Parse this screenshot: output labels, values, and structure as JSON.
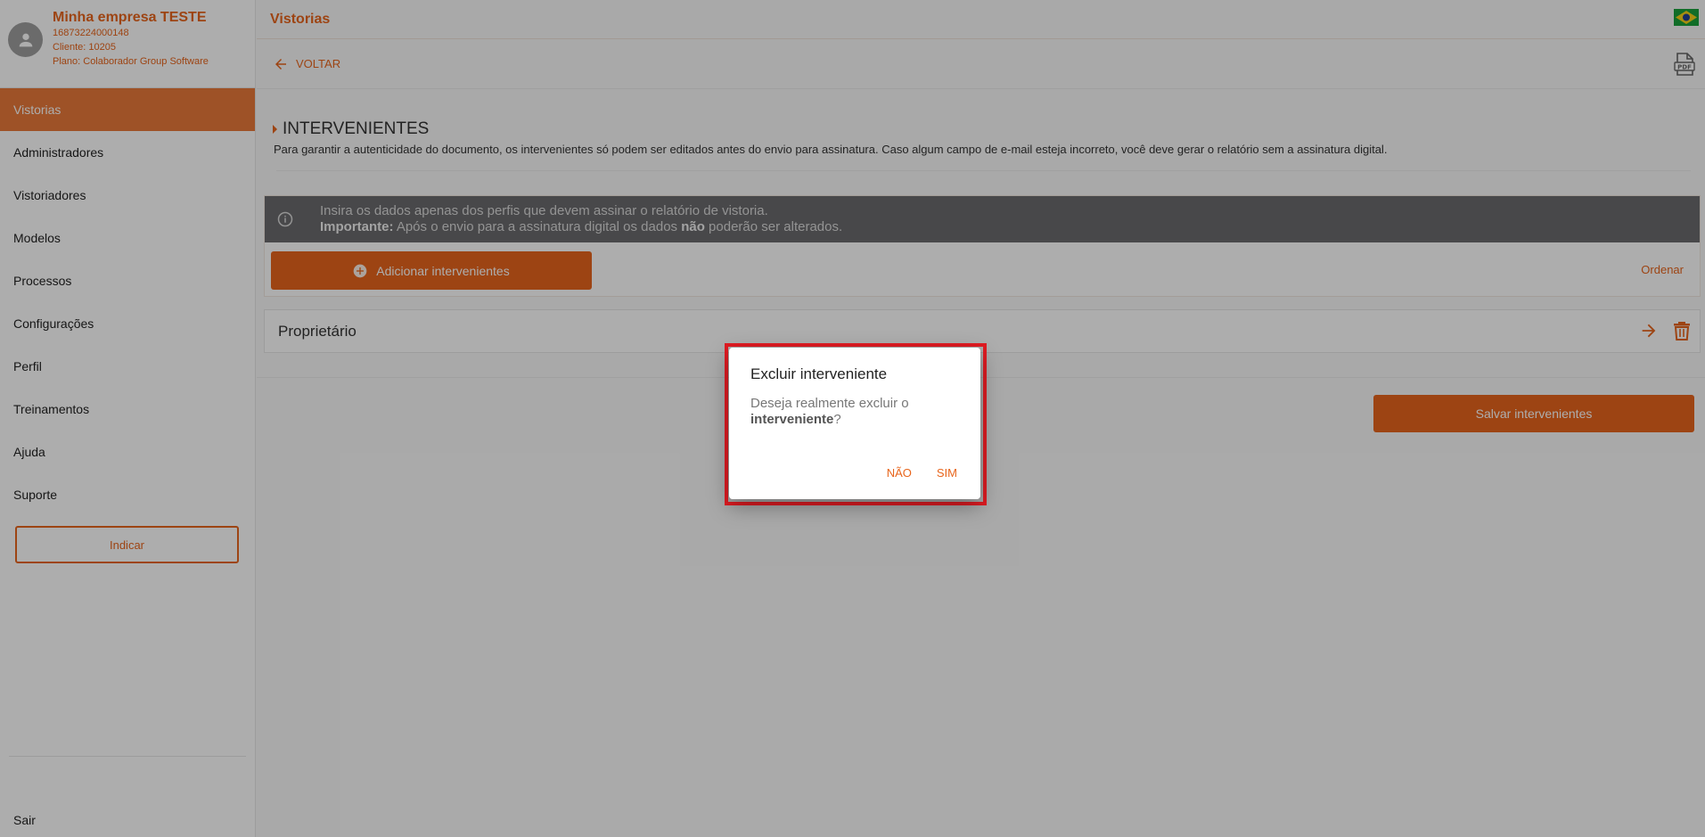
{
  "profile": {
    "company": "Minha empresa TESTE",
    "cnpj": "16873224000148",
    "client": "Cliente: 10205",
    "plan": "Plano: Colaborador Group Software"
  },
  "sidebar": {
    "items": [
      {
        "label": "Vistorias",
        "active": true
      },
      {
        "label": "Administradores"
      },
      {
        "label": "Vistoriadores"
      },
      {
        "label": "Modelos"
      },
      {
        "label": "Processos"
      },
      {
        "label": "Configurações"
      },
      {
        "label": "Perfil"
      },
      {
        "label": "Treinamentos"
      },
      {
        "label": "Ajuda"
      },
      {
        "label": "Suporte"
      }
    ],
    "indicar_label": "Indicar",
    "logout_label": "Sair"
  },
  "header": {
    "title": "Vistorias",
    "back_label": "VOLTAR"
  },
  "section": {
    "title": "INTERVENIENTES",
    "description": "Para garantir a autenticidade do documento, os intervenientes só podem ser editados antes do envio para assinatura. Caso algum campo de e-mail esteja incorreto, você deve gerar o relatório sem a assinatura digital."
  },
  "info": {
    "line1": "Insira os dados apenas dos perfis que devem assinar o relatório de vistoria.",
    "important_label": "Importante:",
    "line2_a": " Após o envio para a assinatura digital os dados ",
    "line2_bold": "não",
    "line2_b": " poderão ser alterados."
  },
  "actions": {
    "add_label": "Adicionar intervenientes",
    "order_label": "Ordenar",
    "save_label": "Salvar intervenientes"
  },
  "interveniente": {
    "name": "Proprietário"
  },
  "dialog": {
    "title": "Excluir interveniente",
    "body_a": "Deseja realmente excluir o ",
    "body_bold": "interveniente",
    "body_b": "?",
    "no_label": "NÃO",
    "yes_label": "SIM"
  },
  "colors": {
    "accent": "#e8651c",
    "highlight": "#e11b22"
  }
}
